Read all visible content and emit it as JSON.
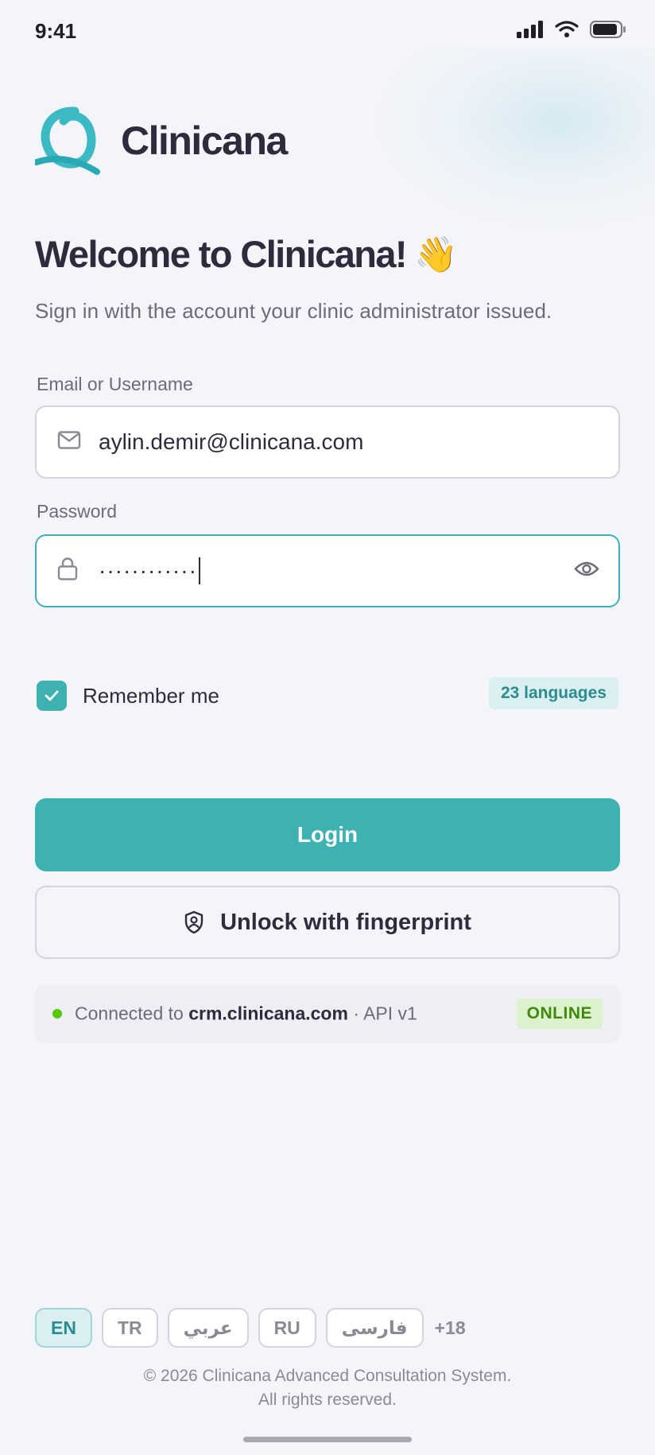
{
  "status_bar": {
    "time": "9:41"
  },
  "brand": {
    "name": "Clinicana",
    "accent": "#3eb1b3"
  },
  "welcome": {
    "title": "Welcome to Clinicana!",
    "emoji": "👋",
    "subtitle": "Sign in with the account your clinic administrator issued."
  },
  "form": {
    "email": {
      "label": "Email or Username",
      "value": "aylin.demir@clinicana.com",
      "icon": "mail-icon"
    },
    "password": {
      "label": "Password",
      "value": "············",
      "icon": "lock-icon",
      "toggle_icon": "eye-icon"
    },
    "remember": {
      "label": "Remember me",
      "checked": true
    },
    "languages_badge": "23 languages"
  },
  "actions": {
    "login_label": "Login",
    "fingerprint_label": "Unlock with fingerprint",
    "fingerprint_icon": "shield-icon"
  },
  "connection": {
    "prefix": "Connected to",
    "host": "crm.clinicana.com",
    "suffix": "· API v1",
    "status": "ONLINE",
    "status_color": "#56ca00"
  },
  "languages": [
    {
      "code": "EN",
      "active": true
    },
    {
      "code": "TR",
      "active": false
    },
    {
      "code": "عربي",
      "active": false
    },
    {
      "code": "RU",
      "active": false
    },
    {
      "code": "فارسی",
      "active": false
    }
  ],
  "languages_more": "+18",
  "footer": {
    "line1": "© 2026 Clinicana Advanced Consultation System.",
    "line2": "All rights reserved."
  }
}
